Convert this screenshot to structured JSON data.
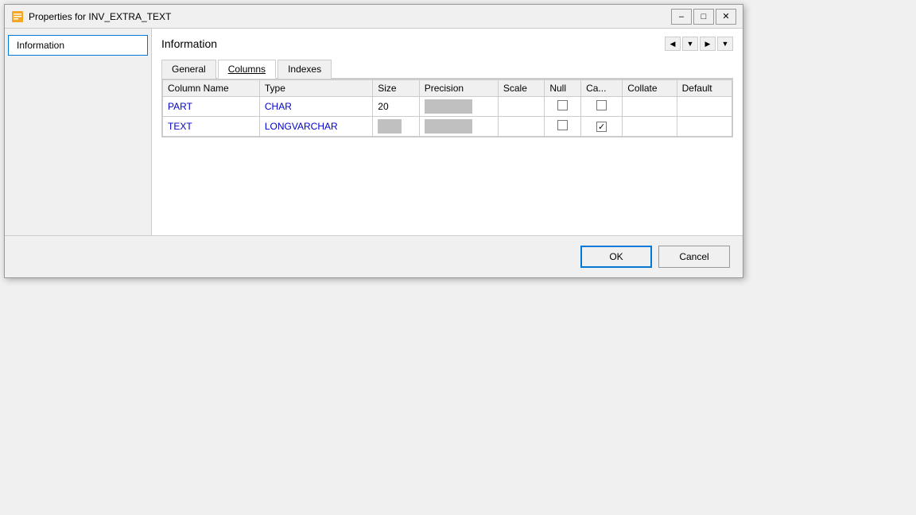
{
  "titleBar": {
    "icon": "table-icon",
    "title": "Properties for INV_EXTRA_TEXT",
    "minimizeLabel": "–",
    "maximizeLabel": "□",
    "closeLabel": "✕"
  },
  "sidebar": {
    "items": [
      {
        "id": "information",
        "label": "Information",
        "active": true
      }
    ]
  },
  "mainContent": {
    "header": "Information",
    "navArrows": [
      "◀",
      "▾",
      "▶",
      "▾"
    ]
  },
  "tabs": [
    {
      "id": "general",
      "label": "General",
      "active": false
    },
    {
      "id": "columns",
      "label": "Columns",
      "active": true
    },
    {
      "id": "indexes",
      "label": "Indexes",
      "active": false
    }
  ],
  "table": {
    "columns": [
      {
        "id": "col-name",
        "label": "Column Name"
      },
      {
        "id": "type",
        "label": "Type"
      },
      {
        "id": "size",
        "label": "Size"
      },
      {
        "id": "precision",
        "label": "Precision"
      },
      {
        "id": "scale",
        "label": "Scale"
      },
      {
        "id": "null",
        "label": "Null"
      },
      {
        "id": "ca",
        "label": "Ca..."
      },
      {
        "id": "collate",
        "label": "Collate"
      },
      {
        "id": "default",
        "label": "Default"
      }
    ],
    "rows": [
      {
        "columnName": "PART",
        "type": "CHAR",
        "size": "20",
        "precision": "",
        "scale": "",
        "null": false,
        "ca": false,
        "collate": "",
        "default": ""
      },
      {
        "columnName": "TEXT",
        "type": "LONGVARCHAR",
        "size": "",
        "precision": "",
        "scale": "",
        "null": false,
        "ca": true,
        "collate": "",
        "default": ""
      }
    ]
  },
  "footer": {
    "okLabel": "OK",
    "cancelLabel": "Cancel"
  }
}
